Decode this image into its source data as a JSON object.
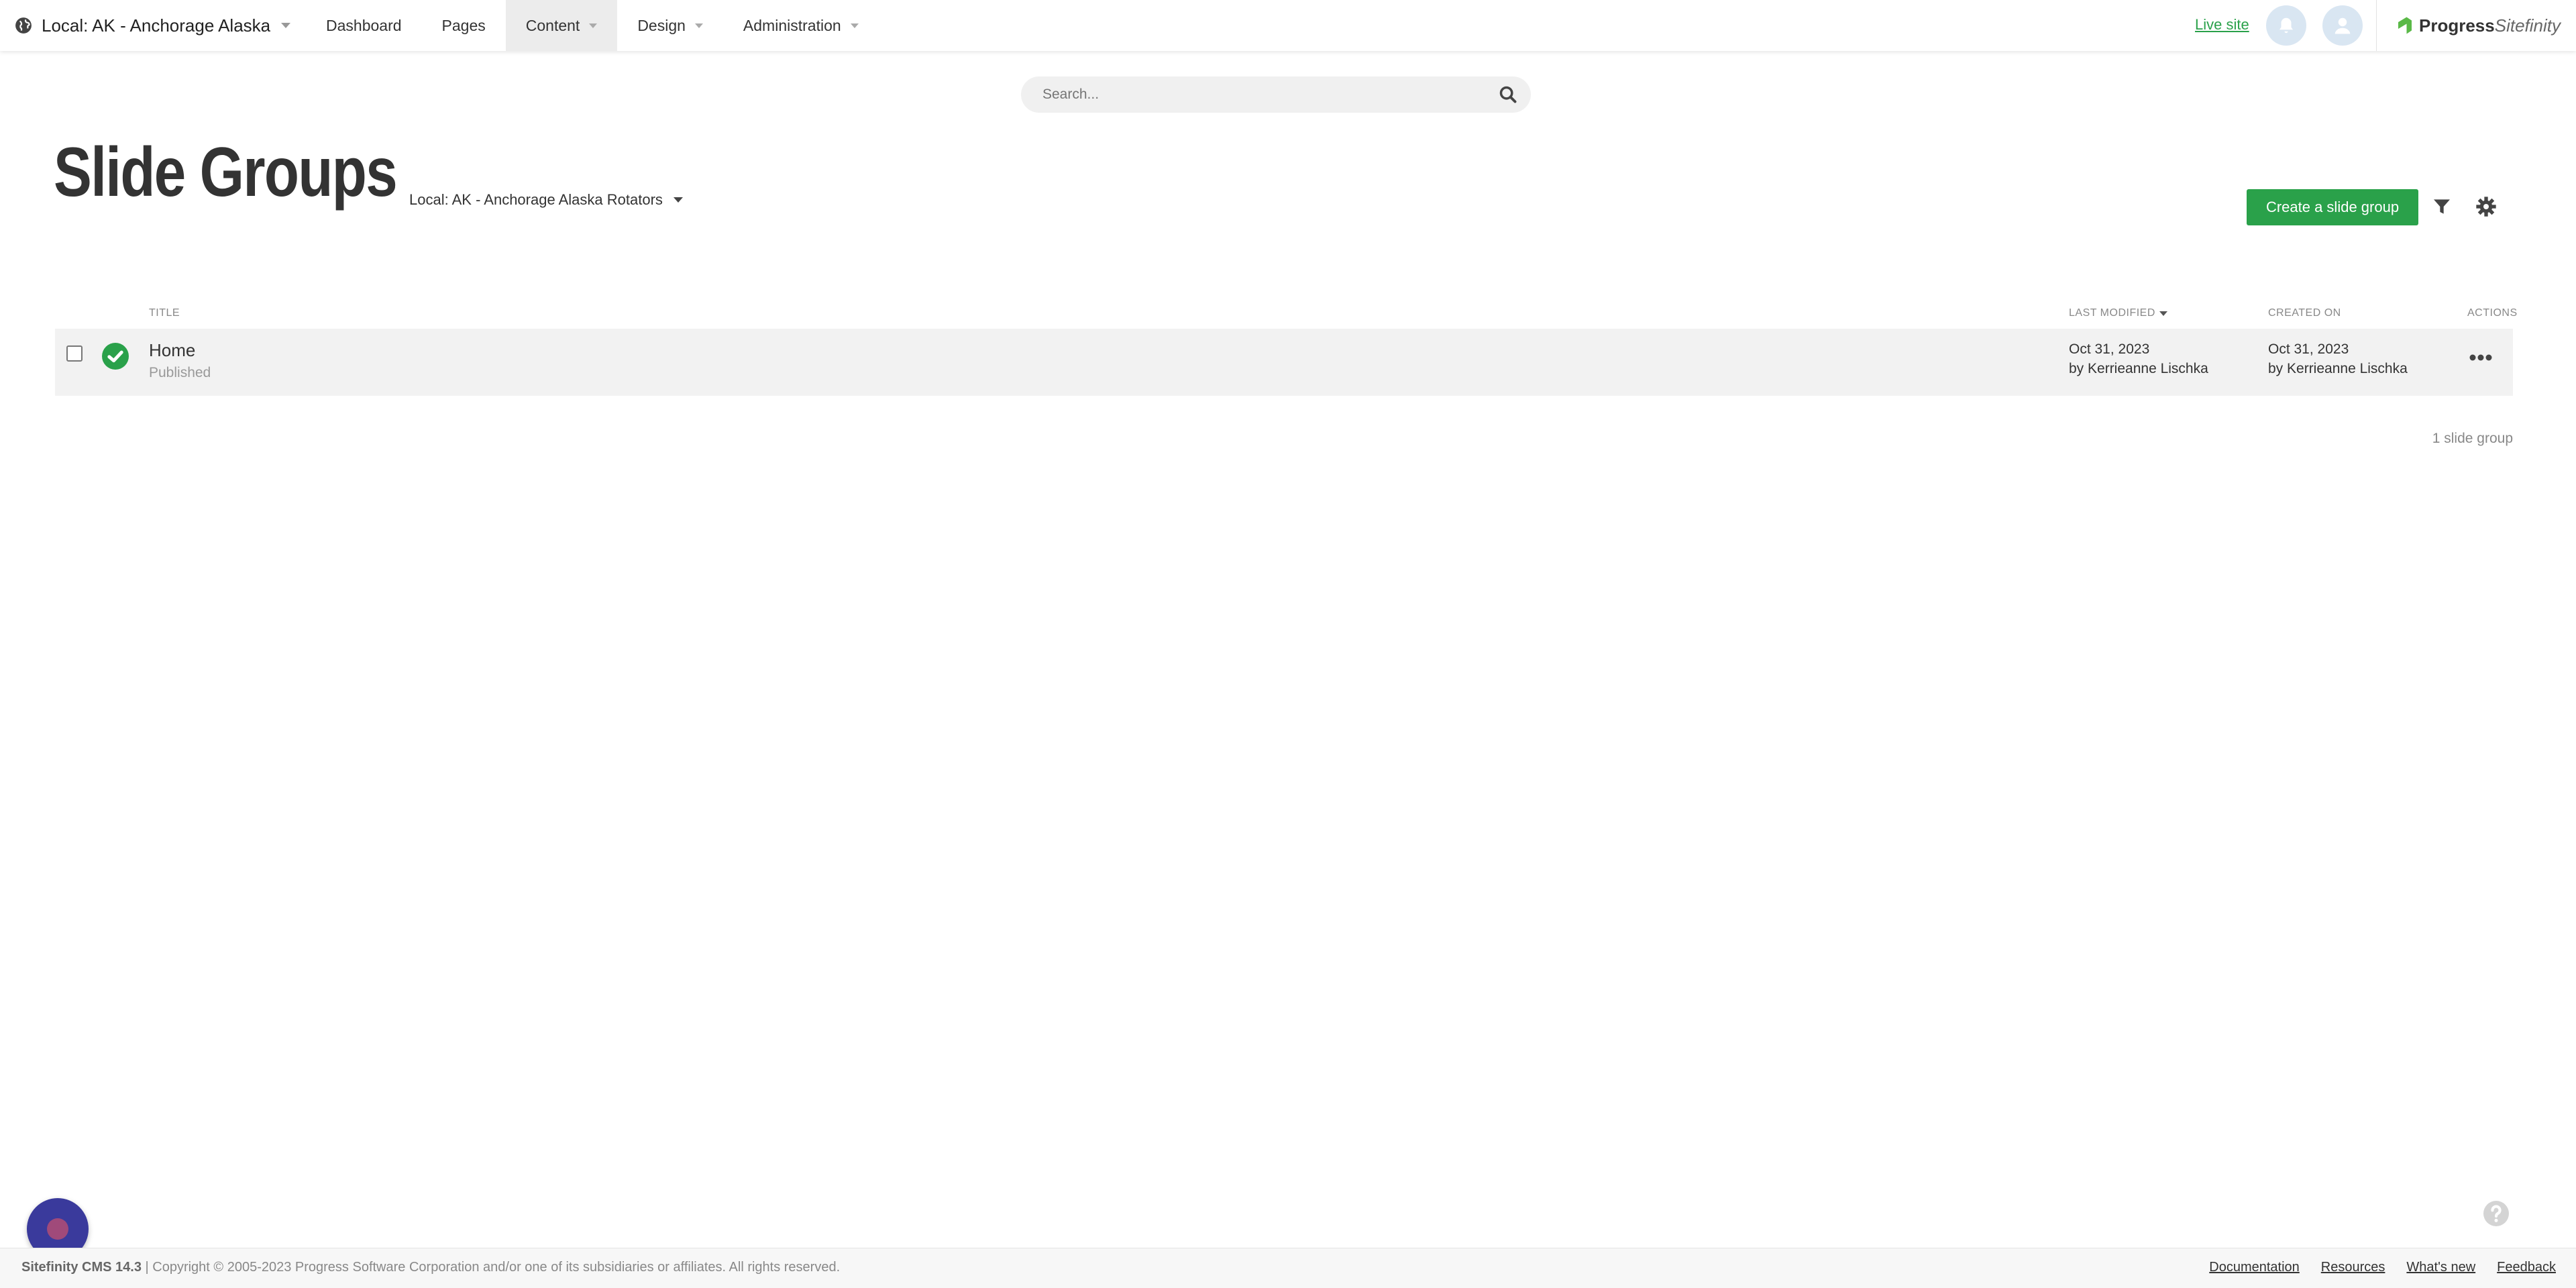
{
  "header": {
    "site_name": "Local: AK - Anchorage Alaska",
    "nav": [
      {
        "label": "Dashboard"
      },
      {
        "label": "Pages"
      },
      {
        "label": "Content"
      },
      {
        "label": "Design"
      },
      {
        "label": "Administration"
      }
    ],
    "live_site": "Live site",
    "brand": "Progress",
    "brand_product": "Sitefinity"
  },
  "search": {
    "placeholder": "Search..."
  },
  "page": {
    "title": "Slide Groups",
    "provider": "Local: AK - Anchorage Alaska Rotators",
    "create_button": "Create a slide group"
  },
  "table": {
    "columns": {
      "title": "TITLE",
      "last_modified": "LAST MODIFIED",
      "created_on": "CREATED ON",
      "actions": "ACTIONS"
    },
    "rows": [
      {
        "title": "Home",
        "status": "Published",
        "modified_date": "Oct 31, 2023",
        "modified_by": "by Kerrieanne Lischka",
        "created_date": "Oct 31, 2023",
        "created_by": "by Kerrieanne Lischka"
      }
    ],
    "count": "1 slide group"
  },
  "footer": {
    "product": "Sitefinity CMS 14.3",
    "copyright": "| Copyright © 2005-2023 Progress Software Corporation and/or one of its subsidiaries or affiliates. All rights reserved.",
    "links": [
      "Documentation",
      "Resources",
      "What's new",
      "Feedback"
    ]
  },
  "colors": {
    "accent": "#2aa14a",
    "fab": "#3a3a9c"
  }
}
